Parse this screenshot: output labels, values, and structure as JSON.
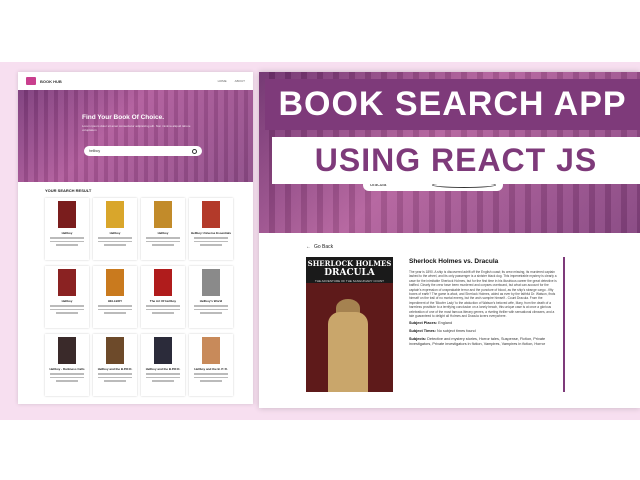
{
  "banner": {
    "line1": "BOOK SEARCH APP",
    "line2": "USING REACT JS"
  },
  "colors": {
    "accent": "#7e3a7a",
    "background": "#f7dff0",
    "brand": "#c93f8e"
  },
  "left_app": {
    "brand": "BOOK HUB",
    "nav": [
      "HOME",
      "ABOUT"
    ],
    "hero_title": "Find Your Book Of Choice.",
    "hero_sub": "Lorem ipsum dolor sit amet consectetur adipisicing elit. Non minima aliquid labore voluptatum",
    "search_value": "hellboy",
    "results_title": "YOUR SEARCH RESULT",
    "books": [
      {
        "title": "Hellboy",
        "color": "#7a1d1d"
      },
      {
        "title": "Hellboy",
        "color": "#d9a62b"
      },
      {
        "title": "Hellboy",
        "color": "#c28b2a"
      },
      {
        "title": "Hellboy Universe Essentials",
        "color": "#b33a2a"
      },
      {
        "title": "Hellboy",
        "color": "#8a2222"
      },
      {
        "title": "HELLBOY",
        "color": "#c97a1e"
      },
      {
        "title": "The Art Of Hellboy",
        "color": "#b01c1c"
      },
      {
        "title": "Hellboy's World",
        "color": "#8a8a8a"
      },
      {
        "title": "Hellboy - Darkness Calls",
        "color": "#3a2a2a"
      },
      {
        "title": "Hellboy and the B.P.R.D.",
        "color": "#6d4a2a"
      },
      {
        "title": "Hellboy and the B.P.R.D.",
        "color": "#2b2b3a"
      },
      {
        "title": "Hellboy and the B. P. R.",
        "color": "#c88a5a"
      }
    ]
  },
  "right_app": {
    "search_value": "dracula",
    "back_label": "Go Back",
    "cover": {
      "line1": "SHERLOCK HOLMES",
      "line2": "DRACULA",
      "line3": "THE ADVENTURE OF THE SANGUINARY COUNT"
    },
    "book_title": "Sherlock Holmes vs. Dracula",
    "description": "The year is 1890. A ship is discovered adrift off the English coast; its crew missing, its murdered captain lashed to the wheel, and its only passenger is a sinister black dog. This impenetrable mystery is clearly a case for the inimitable Sherlock Holmes, but for the first time in his illustrious career the great detective is baffled. Clearly the crew have been murdered and corpses overboard, but what can account for the captain's expression of unspeakable terror and the puncture of blood, as the ship's strange cargo - fifty boxes of earth? The game is afoot, and Sherlock Holmes, aided as ever by the faithful Dr. Watson, finds himself on the trail of no mortal enemy, but the arch-vampire himself - Count Dracula. From the impediment of the 'Bloofer Lady' to the abduction of Watson's beloved wife, Mary, from the death of a harmless prostitute to a terrifying conclusion on a lonely beach, this unique case is at once a glorious celebration of one of the most famous literary genres, a riveting thriller with sensational climaxes, and a tale guaranteed to delight all Holmes and Dracula lovers everywhere.",
    "subject_places_label": "Subject Places:",
    "subject_places": "England",
    "subject_times_label": "Subject Times:",
    "subject_times": "No subject times found",
    "subjects_label": "Subjects:",
    "subjects": "Detective and mystery stories, Horror tales, Suspense, Fiction, Private investigators, Private investigators in fiction, Vampires, Vampires in fiction, Horror"
  }
}
